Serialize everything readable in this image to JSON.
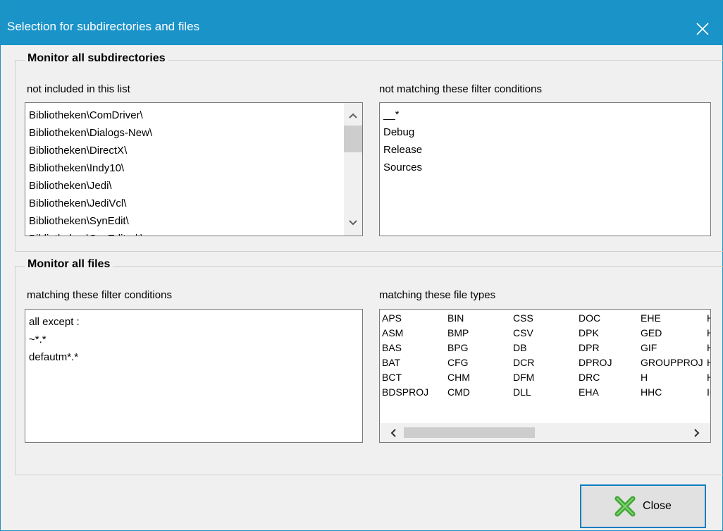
{
  "window": {
    "title": "Selection for subdirectories and files"
  },
  "subdirs": {
    "group_title": "Monitor all subdirectories",
    "excluded_label": "not included in this list",
    "excluded_items": [
      "Bibliotheken\\ComDriver\\",
      "Bibliotheken\\Dialogs-New\\",
      "Bibliotheken\\DirectX\\",
      "Bibliotheken\\Indy10\\",
      "Bibliotheken\\Jedi\\",
      "Bibliotheken\\JediVcl\\",
      "Bibliotheken\\SynEdit\\",
      "Bibliotheken\\SynEdit-alt\\"
    ],
    "filter_label": "not matching these filter conditions",
    "filter_items": [
      "__*",
      "Debug",
      "Release",
      "Sources"
    ]
  },
  "files": {
    "group_title": "Monitor all files",
    "filter_label": "matching these filter conditions",
    "filter_items": [
      "all except :",
      "~*.*",
      "defautm*.*"
    ],
    "types_label": "matching these file types",
    "types_columns": [
      [
        "APS",
        "ASM",
        "BAS",
        "BAT",
        "BCT",
        "BDSPROJ"
      ],
      [
        "BIN",
        "BMP",
        "BPG",
        "CFG",
        "CHM",
        "CMD"
      ],
      [
        "CSS",
        "CSV",
        "DB",
        "DCR",
        "DFM",
        "DLL"
      ],
      [
        "DOC",
        "DPK",
        "DPR",
        "DPROJ",
        "DRC",
        "EHA"
      ],
      [
        "EHE",
        "GED",
        "GIF",
        "GROUPPROJ",
        "H",
        "HHC"
      ],
      [
        "HHK",
        "HHP",
        "HLP",
        "HTM",
        "HTML",
        "ICO"
      ]
    ]
  },
  "buttons": {
    "close_label": "Close"
  },
  "colors": {
    "titlebar": "#1a93c9",
    "accent": "#0f7dc2",
    "close_icon": "#3fa535"
  }
}
